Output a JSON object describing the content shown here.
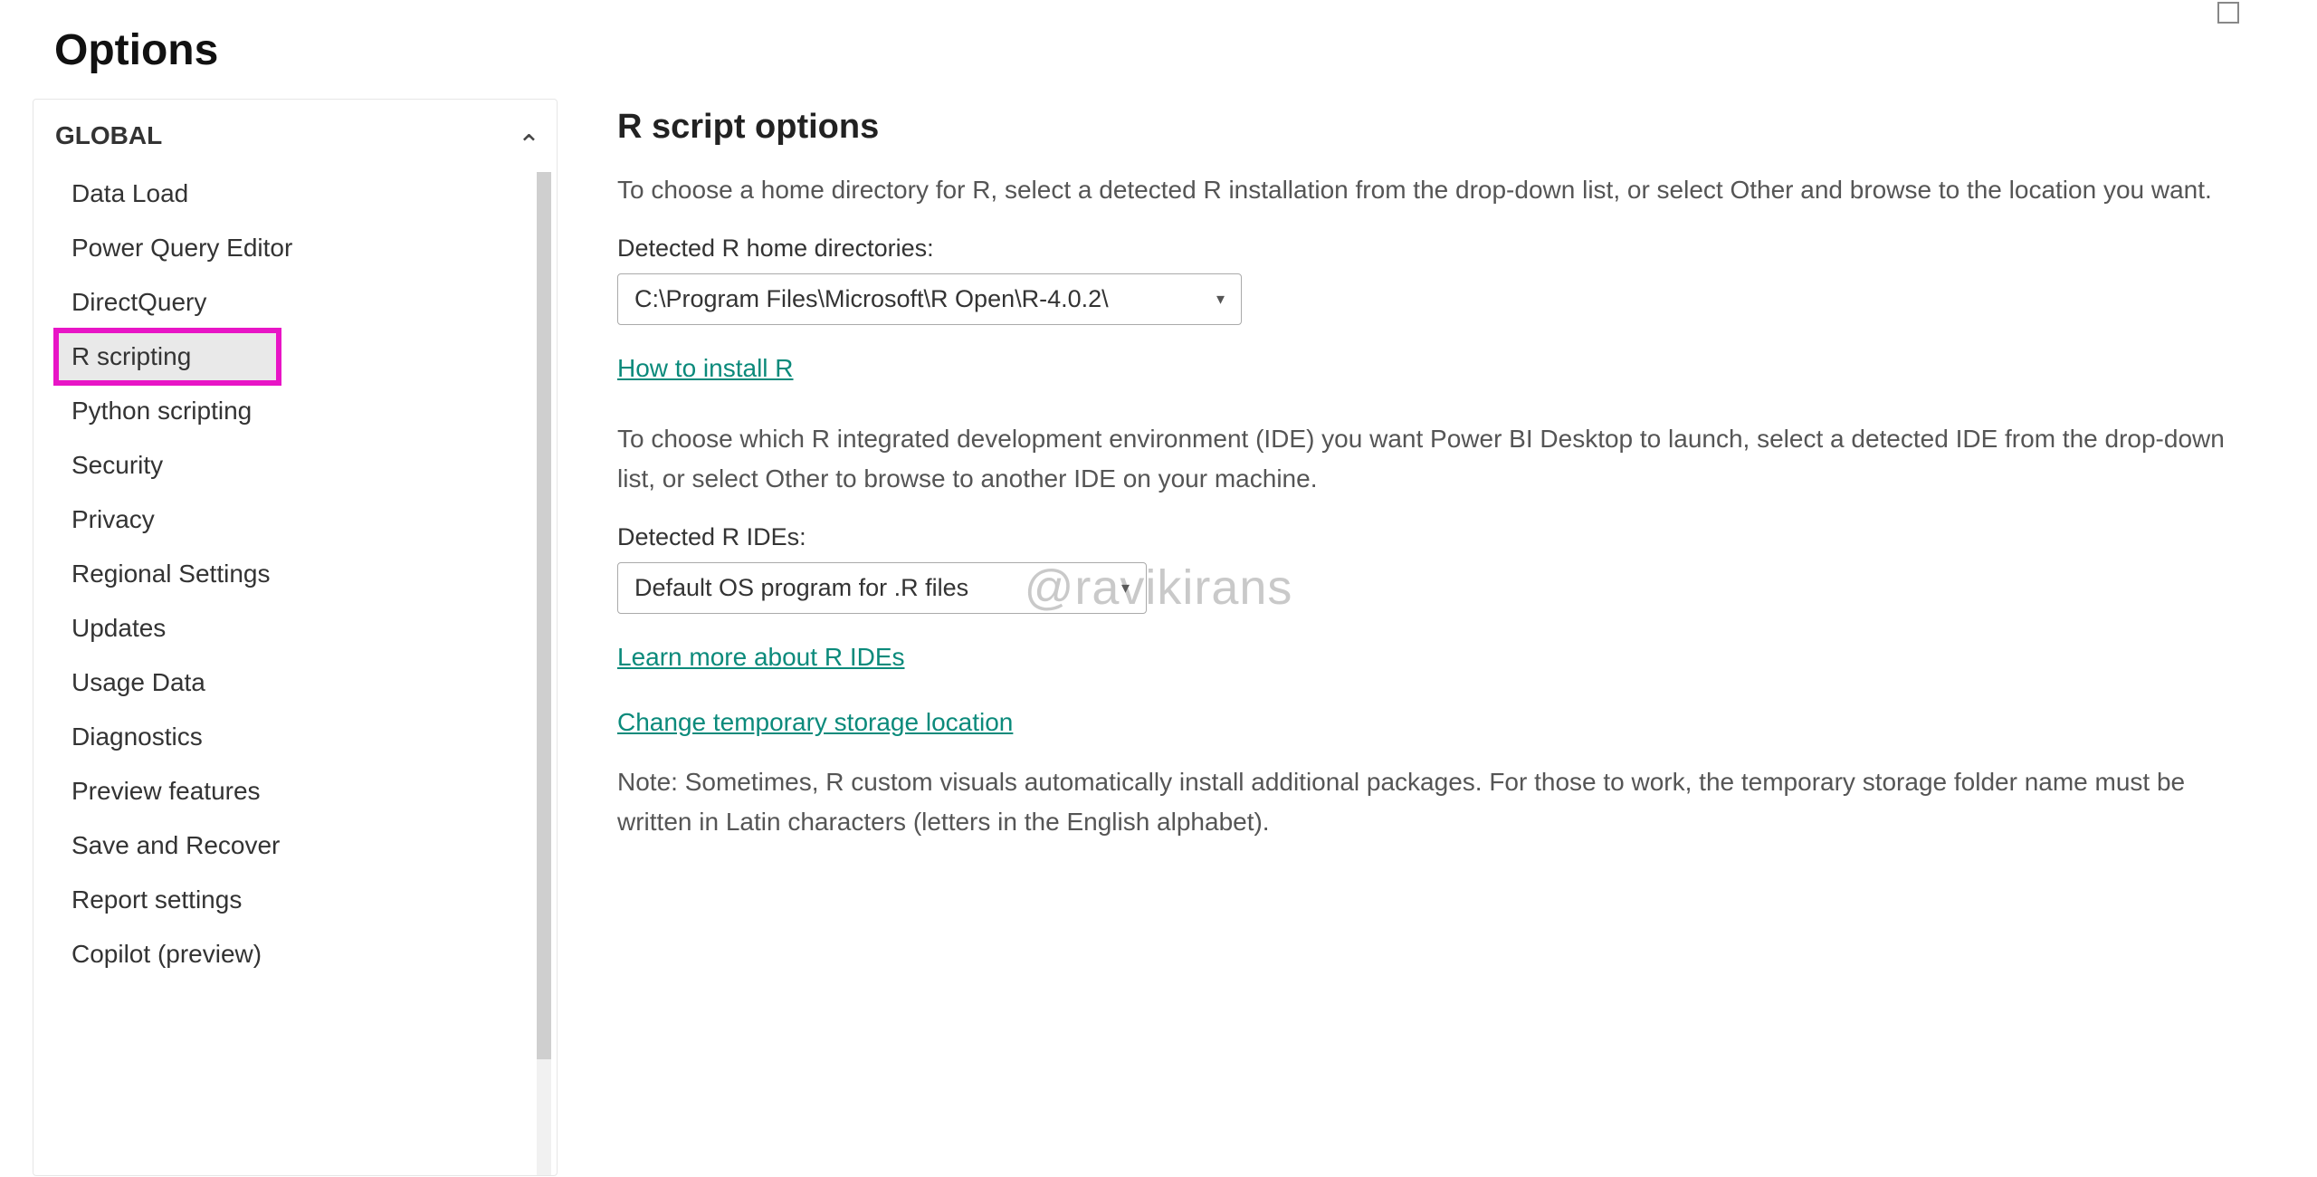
{
  "window": {
    "title": "Options"
  },
  "sidebar": {
    "section_label": "GLOBAL",
    "items": [
      {
        "label": "Data Load"
      },
      {
        "label": "Power Query Editor"
      },
      {
        "label": "DirectQuery"
      },
      {
        "label": "R scripting",
        "selected": true,
        "highlighted": true
      },
      {
        "label": "Python scripting"
      },
      {
        "label": "Security"
      },
      {
        "label": "Privacy"
      },
      {
        "label": "Regional Settings"
      },
      {
        "label": "Updates"
      },
      {
        "label": "Usage Data"
      },
      {
        "label": "Diagnostics"
      },
      {
        "label": "Preview features"
      },
      {
        "label": "Save and Recover"
      },
      {
        "label": "Report settings"
      },
      {
        "label": "Copilot (preview)"
      }
    ]
  },
  "main": {
    "heading": "R script options",
    "intro_home": "To choose a home directory for R, select a detected R installation from the drop-down list, or select Other and browse to the location you want.",
    "home_dir_label": "Detected R home directories:",
    "home_dir_value": "C:\\Program Files\\Microsoft\\R Open\\R-4.0.2\\",
    "install_r_link": "How to install R",
    "intro_ide": "To choose which R integrated development environment (IDE) you want Power BI Desktop to launch, select a detected IDE from the drop-down list, or select Other to browse to another IDE on your machine.",
    "ide_label": "Detected R IDEs:",
    "ide_value": "Default OS program for .R files",
    "learn_ide_link": "Learn more about R IDEs",
    "temp_storage_link": "Change temporary storage location",
    "note_text": "Note: Sometimes, R custom visuals automatically install additional packages. For those to work, the temporary storage folder name must be written in Latin characters (letters in the English alphabet)."
  },
  "watermark": "@ravikirans"
}
